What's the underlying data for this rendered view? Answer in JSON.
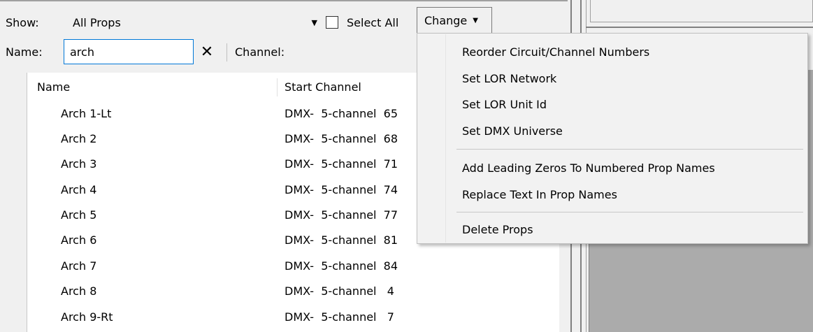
{
  "toolbar": {
    "show_label": "Show:",
    "show_value": "All Props",
    "select_all_label": "Select All",
    "change_label": "Change",
    "name_label": "Name:",
    "name_value": "arch",
    "channel_label": "Channel:"
  },
  "icons": {
    "dropdown": "chevron-down-icon",
    "clear": "close-icon"
  },
  "list": {
    "columns": [
      "Name",
      "Start Channel"
    ],
    "rows": [
      {
        "name": "Arch 1-Lt",
        "channel": "DMX-  5-channel  65"
      },
      {
        "name": "Arch 2",
        "channel": "DMX-  5-channel  68"
      },
      {
        "name": "Arch 3",
        "channel": "DMX-  5-channel  71"
      },
      {
        "name": "Arch 4",
        "channel": "DMX-  5-channel  74"
      },
      {
        "name": "Arch 5",
        "channel": "DMX-  5-channel  77"
      },
      {
        "name": "Arch 6",
        "channel": "DMX-  5-channel  81"
      },
      {
        "name": "Arch 7",
        "channel": "DMX-  5-channel  84"
      },
      {
        "name": "Arch 8",
        "channel": "DMX-  5-channel   4"
      },
      {
        "name": "Arch 9-Rt",
        "channel": "DMX-  5-channel   7"
      }
    ]
  },
  "change_menu": {
    "items": [
      "Reorder Circuit/Channel Numbers",
      "Set LOR Network",
      "Set LOR Unit Id",
      "Set DMX Universe",
      "Add Leading Zeros To Numbered Prop Names",
      "Replace Text In Prop Names",
      "Delete Props"
    ]
  },
  "colors": {
    "background": "#f0f0f0",
    "input_focus_border": "#0078d7",
    "preview_gray": "#ababab"
  }
}
